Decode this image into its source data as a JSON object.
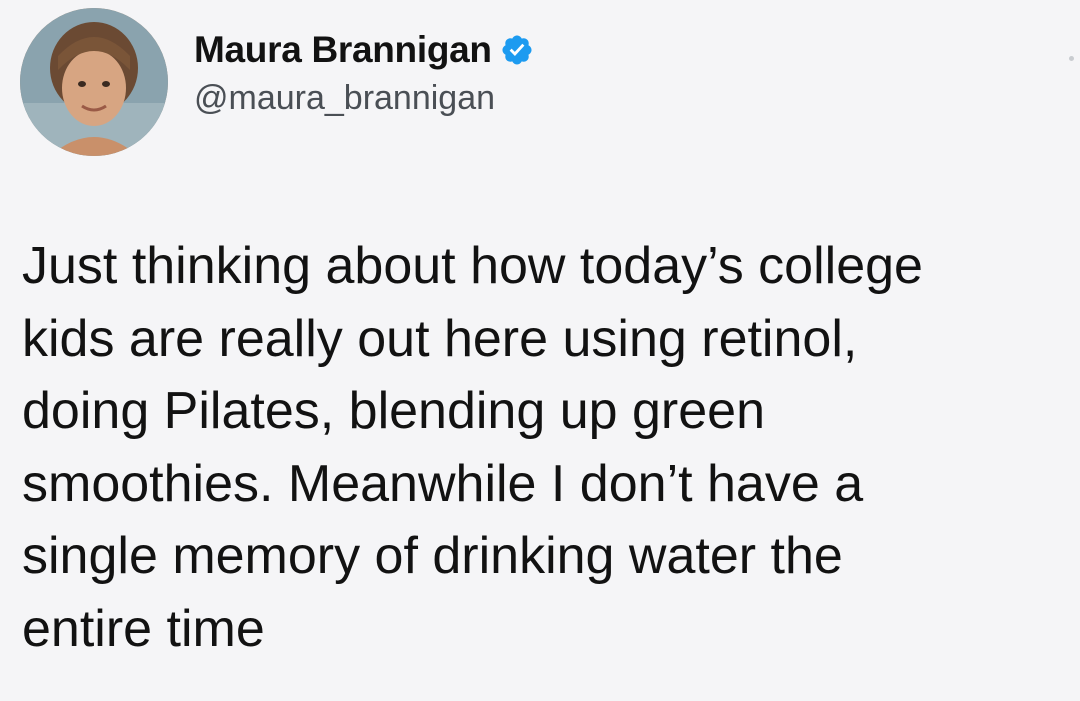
{
  "author": {
    "display_name": "Maura Brannigan",
    "handle": "@maura_brannigan",
    "verified": true
  },
  "tweet": {
    "lines": [
      "Just thinking about how today’s college",
      "kids are really out here using retinol,",
      "doing Pilates, blending up green",
      "smoothies. Meanwhile I don’t have a",
      "single memory of drinking water the",
      "entire time"
    ]
  },
  "icons": {
    "verified_badge": "verified-check-icon",
    "more_menu": "more-options-icon"
  },
  "colors": {
    "background": "#f5f5f7",
    "text": "#121212",
    "handle": "#4a4f55",
    "verified_blue": "#1d9bf0"
  }
}
